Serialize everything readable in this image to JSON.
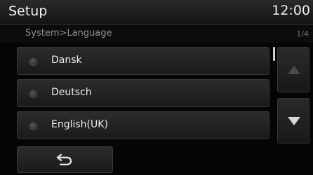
{
  "header": {
    "title": "Setup",
    "clock": "12:00"
  },
  "breadcrumb": {
    "path": "System>Language",
    "page": "1/4"
  },
  "languages": [
    {
      "label": "Dansk"
    },
    {
      "label": "Deutsch"
    },
    {
      "label": "English(UK)"
    }
  ],
  "icons": {
    "scroll_up": "triangle-up-icon",
    "scroll_down": "triangle-down-icon",
    "back": "return-arrow-icon"
  },
  "colors": {
    "background": "#050505",
    "text": "#ececec",
    "breadcrumb": "#8f8f8f",
    "button": "#222222"
  }
}
